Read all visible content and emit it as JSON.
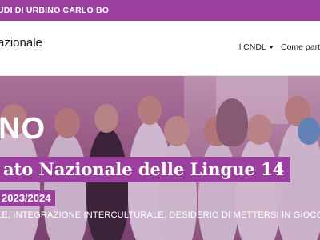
{
  "topbar": {
    "university": "UDI DI URBINO CARLO BO"
  },
  "navbar": {
    "brand": "azionale",
    "items": [
      {
        "label": "Il CNDL",
        "dropdown": true
      },
      {
        "label": "Come parte"
      }
    ]
  },
  "hero": {
    "big_text": "NO",
    "title": "ato Nazionale delle Lingue 14",
    "year": "2023/2024",
    "tagline": "LE, INTEGRAZIONE INTERCULTURALE, DESIDERIO DI METTERSI IN GIOCO E"
  },
  "colors": {
    "brand_purple": "#9b3f9f"
  }
}
